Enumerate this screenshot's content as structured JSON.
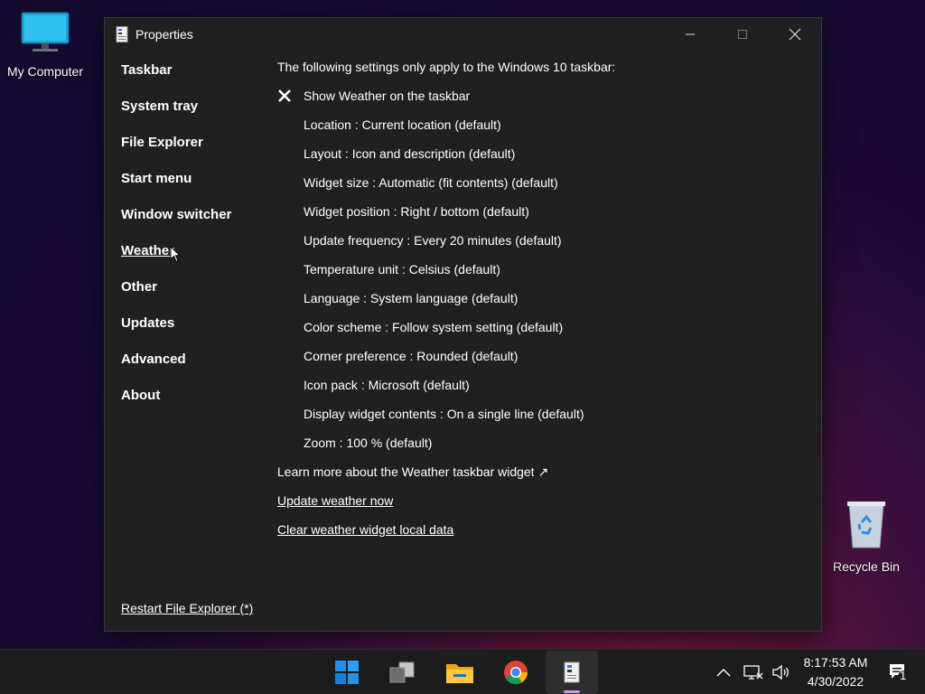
{
  "desktop": {
    "icons": [
      {
        "label": "My Computer"
      },
      {
        "label": "Recycle Bin"
      }
    ]
  },
  "window": {
    "title": "Properties",
    "controls": {
      "minimize": "minimize-icon",
      "maximize": "maximize-icon",
      "close": "close-icon"
    }
  },
  "sidebar": {
    "items": [
      {
        "label": "Taskbar"
      },
      {
        "label": "System tray"
      },
      {
        "label": "File Explorer"
      },
      {
        "label": "Start menu"
      },
      {
        "label": "Window switcher"
      },
      {
        "label": "Weather",
        "active": true
      },
      {
        "label": "Other"
      },
      {
        "label": "Updates"
      },
      {
        "label": "Advanced"
      },
      {
        "label": "About"
      }
    ],
    "restart_link": "Restart File Explorer (*)"
  },
  "content": {
    "heading": "The following settings only apply to the Windows 10 taskbar:",
    "toggle": {
      "label": "Show Weather on the taskbar",
      "icon": "x-mark-icon"
    },
    "settings": [
      "Location : Current location (default)",
      "Layout : Icon and description (default)",
      "Widget size : Automatic (fit contents) (default)",
      "Widget position : Right / bottom (default)",
      "Update frequency : Every 20 minutes (default)",
      "Temperature unit : Celsius (default)",
      "Language : System language (default)",
      "Color scheme : Follow system setting (default)",
      "Corner preference : Rounded (default)",
      "Icon pack : Microsoft (default)",
      "Display widget contents : On a single line (default)",
      "Zoom : 100 % (default)"
    ],
    "learn_more": "Learn more about the Weather taskbar widget ↗",
    "update_now": "Update weather now",
    "clear_data": "Clear weather widget local data"
  },
  "taskbar": {
    "apps": [
      "start-icon",
      "task-view-icon",
      "file-explorer-icon",
      "chrome-icon",
      "properties-app-icon"
    ],
    "tray_icons": [
      "chevron-up-icon",
      "network-icon",
      "volume-icon"
    ],
    "time": "8:17:53 AM",
    "date": "4/30/2022",
    "notification_count": "1"
  },
  "colors": {
    "window_bg": "#202020",
    "taskbar_bg": "#1c1c1c",
    "active_indicator": "#c79be8"
  }
}
